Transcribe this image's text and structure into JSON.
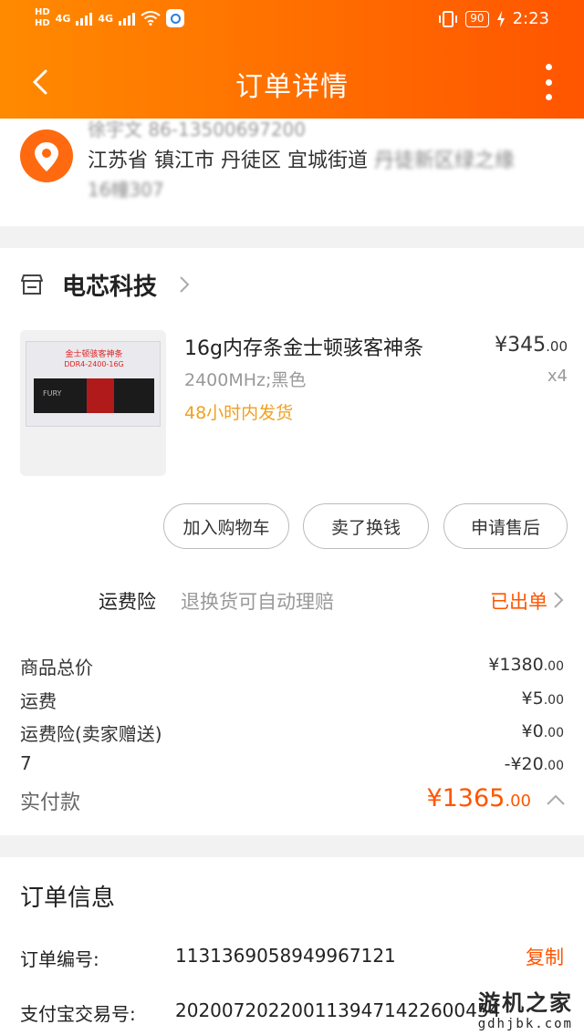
{
  "status_bar": {
    "hd1": "HD",
    "hd2": "HD",
    "net1": "4G",
    "net2": "4G",
    "battery": "90",
    "time": "2:23"
  },
  "nav": {
    "title": "订单详情"
  },
  "address": {
    "name_blurred": "徐宇文  86-13500697200",
    "line1": "江苏省 镇江市 丹徒区 宜城街道",
    "line1_blurred": "丹徒新区绿之缘",
    "line2_blurred": "16幢307"
  },
  "shop": {
    "name": "电芯科技",
    "product": {
      "name": "16g内存条金士顿骇客神条",
      "spec": "2400MHz;黑色",
      "ship_note": "48小时内发货",
      "price_int": "¥345",
      "price_dec": ".00",
      "qty": "x4",
      "image_text_1": "金士顿骇客神条",
      "image_text_2": "DDR4-2400-16G",
      "image_text_3": "FURY"
    },
    "buttons": {
      "add_cart": "加入购物车",
      "resell": "卖了换钱",
      "after_sale": "申请售后"
    },
    "insurance": {
      "label": "运费险",
      "desc": "退换货可自动理赔",
      "status": "已出单"
    },
    "summary": [
      {
        "label": "商品总价",
        "int": "¥1380",
        "dec": ".00"
      },
      {
        "label": "运费",
        "int": "¥5",
        "dec": ".00"
      },
      {
        "label": "运费险(卖家赠送)",
        "int": "¥0",
        "dec": ".00"
      },
      {
        "label": "7",
        "int": "-¥20",
        "dec": ".00"
      }
    ],
    "total": {
      "label": "实付款",
      "int": "¥1365",
      "dec": ".00"
    }
  },
  "order_info": {
    "heading": "订单信息",
    "order_no_label": "订单编号:",
    "order_no": "1131369058949967121",
    "copy": "复制",
    "alipay_label": "支付宝交易号:",
    "alipay_no": "2020072022001139471422600454"
  },
  "watermark": {
    "line1": "游机之家",
    "line2": "gdhjbk.com"
  },
  "colors": {
    "accent": "#ff5500",
    "header_start": "#ff8a00",
    "ship_note": "#f0a020"
  }
}
